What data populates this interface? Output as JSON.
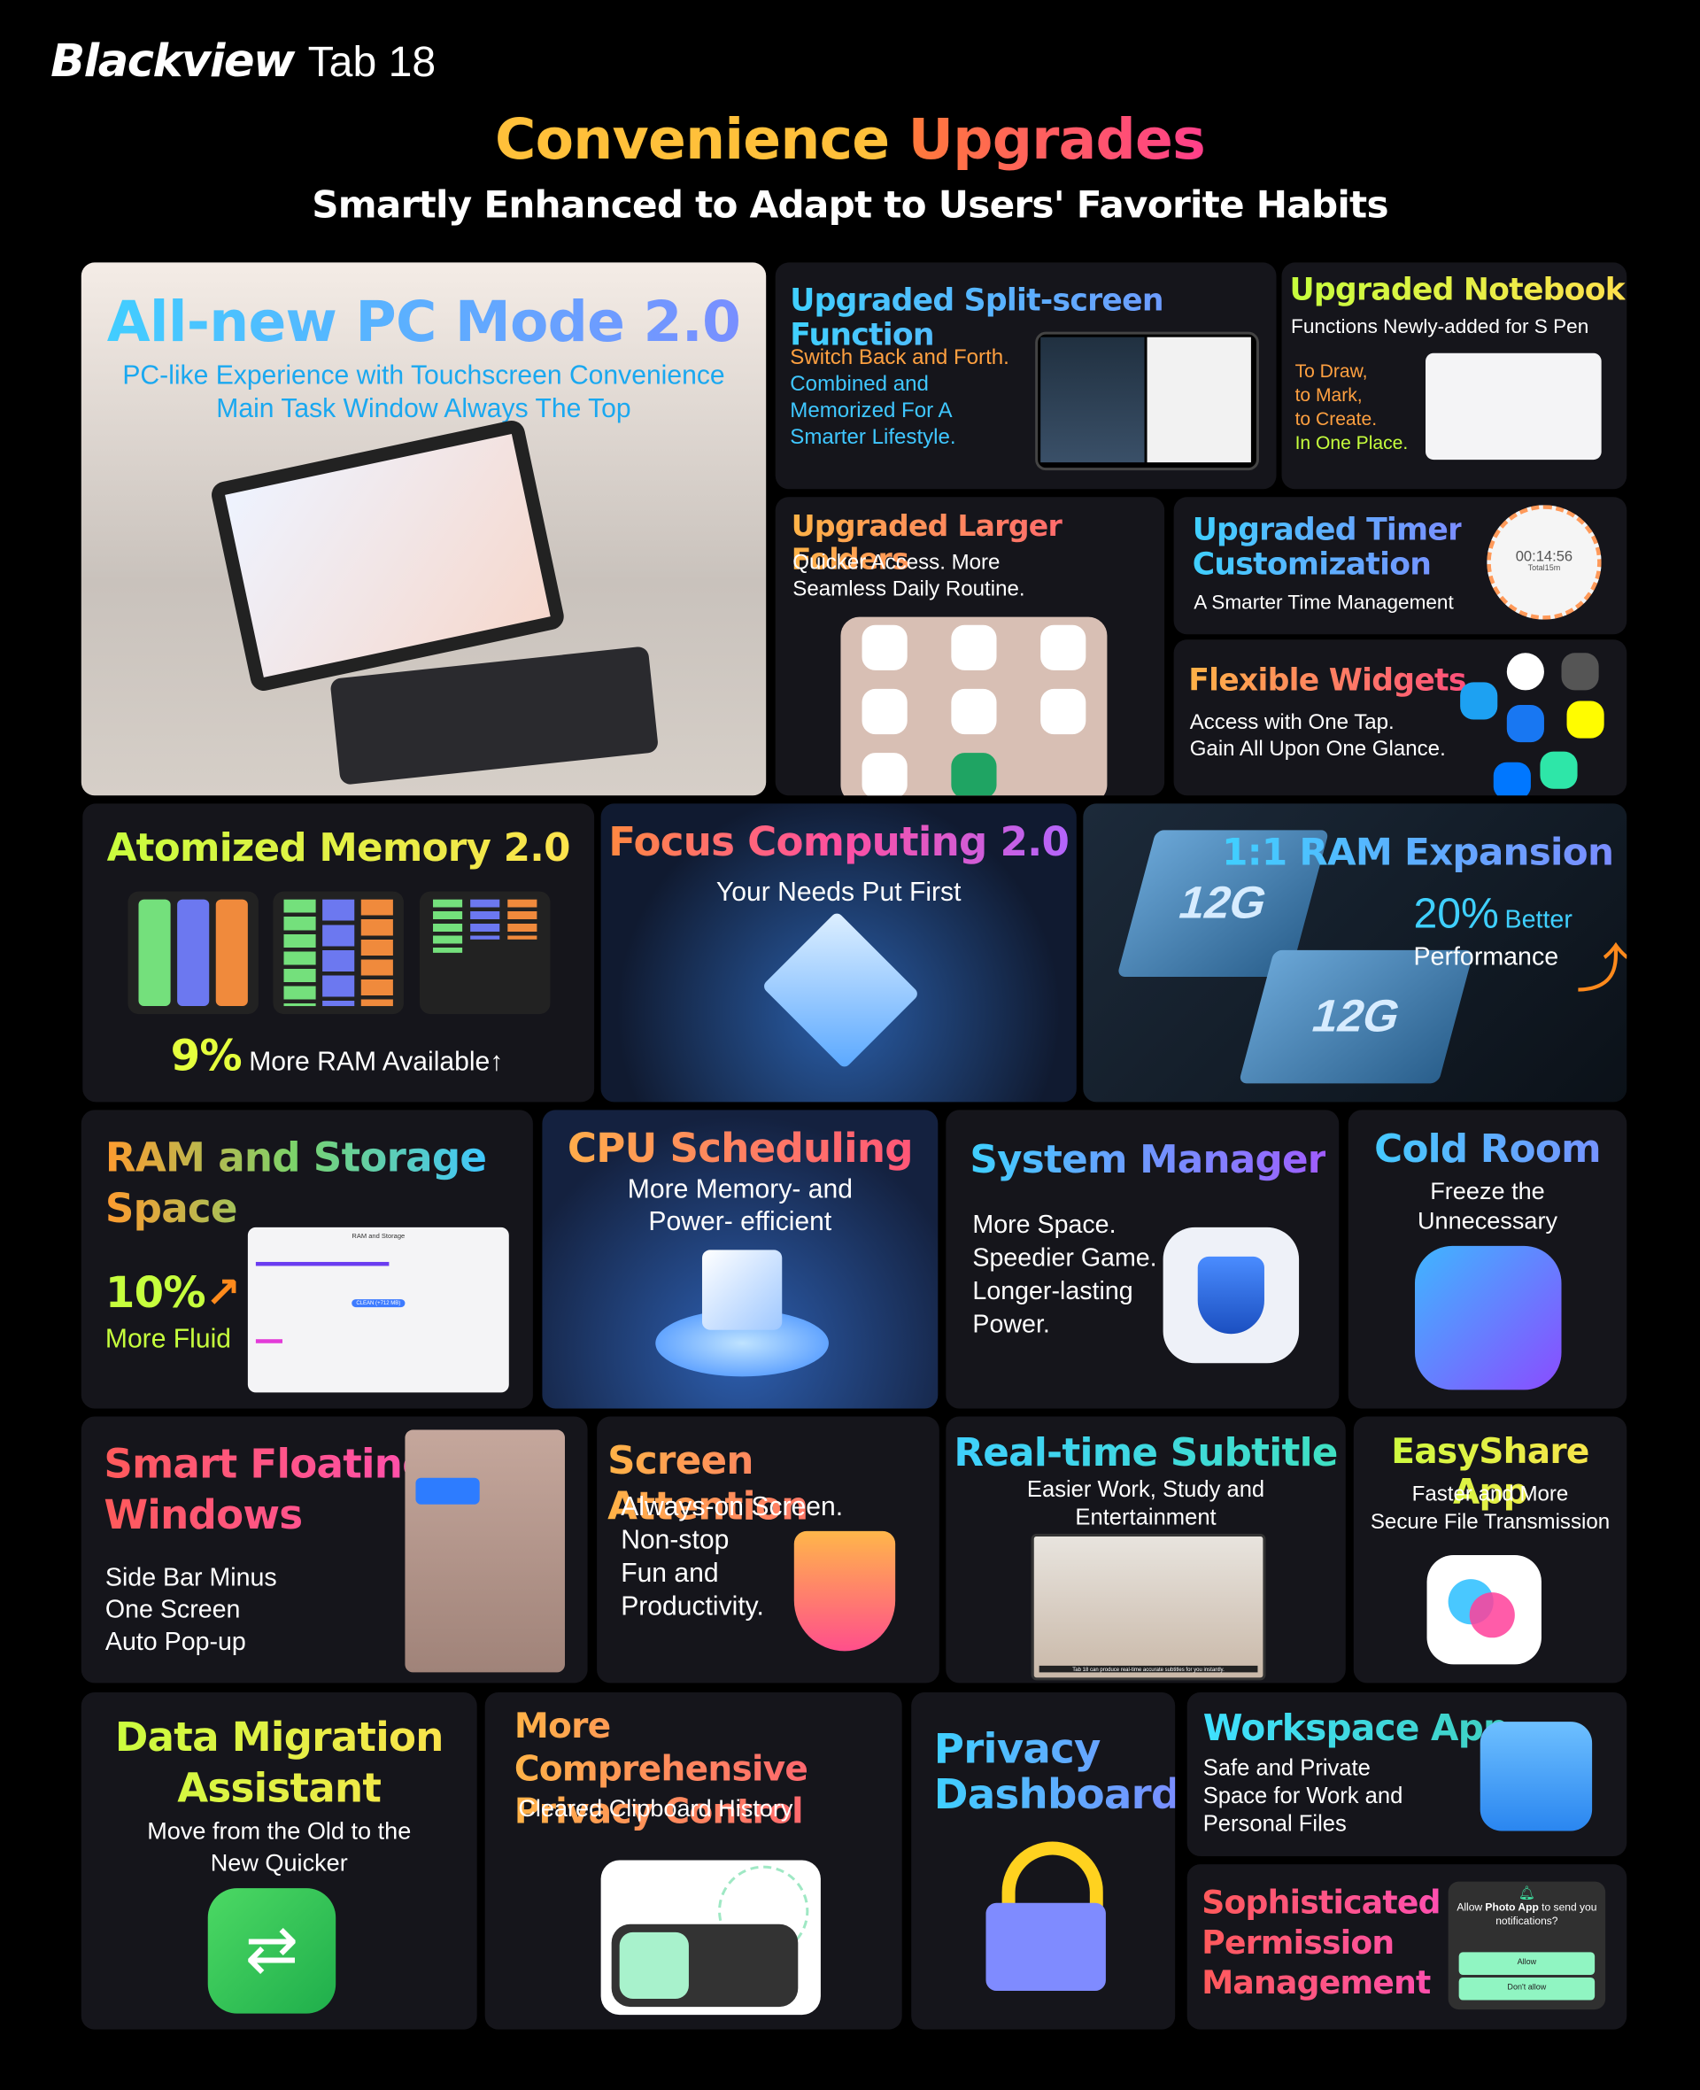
{
  "brand": {
    "logo": "Blackview",
    "model": "Tab 18"
  },
  "header": {
    "title_a": "Convenience",
    "title_b": "Upgrades",
    "subtitle": "Smartly Enhanced to Adapt to Users' Favorite Habits"
  },
  "pc_mode": {
    "title": "All-new PC Mode 2.0",
    "line1": "PC-like Experience with Touchscreen Convenience",
    "line2": "Main Task Window Always The Top"
  },
  "split": {
    "title": "Upgraded Split-screen Function",
    "l1": "Switch Back and Forth.",
    "l2": "Combined and",
    "l3": "Memorized For A",
    "l4": "Smarter Lifestyle."
  },
  "notebook": {
    "title": "Upgraded Notebook",
    "sub": "Functions Newly-added for S Pen",
    "l1": "To Draw,",
    "l2": "to Mark,",
    "l3": "to Create.",
    "l4": "In One Place."
  },
  "folders": {
    "title": "Upgraded Larger Folders",
    "l1": "Quicker Access. More",
    "l2": "Seamless Daily Routine."
  },
  "timer": {
    "title1": "Upgraded Timer",
    "title2": "Customization",
    "sub": "A Smarter Time Management",
    "time": "00:14:56",
    "total": "Total15m"
  },
  "widgets": {
    "title": "Flexible Widgets",
    "l1": "Access with One Tap.",
    "l2": "Gain All Upon One Glance."
  },
  "atomized": {
    "title": "Atomized Memory 2.0",
    "pct": "9%",
    "text": "More RAM Available↑"
  },
  "focus": {
    "title": "Focus Computing 2.0",
    "sub": "Your Needs Put First"
  },
  "ram_exp": {
    "title": "1:1 RAM Expansion",
    "pct": "20%",
    "better": "Better",
    "perf": "Performance",
    "chip1": "12G",
    "chip2": "12G"
  },
  "ram_storage": {
    "title1": "RAM and Storage",
    "title2": "Space",
    "pct": "10%",
    "text": "More Fluid",
    "screen_title": "RAM and Storage",
    "clean": "CLEAN (+712 MB)"
  },
  "cpu": {
    "title": "CPU Scheduling",
    "l1": "More Memory- and",
    "l2": "Power- efficient"
  },
  "sysman": {
    "title": "System Manager",
    "l1": "More Space.",
    "l2": "Speedier Game.",
    "l3": "Longer-lasting",
    "l4": "Power."
  },
  "cold": {
    "title": "Cold Room",
    "l1": "Freeze the",
    "l2": "Unnecessary"
  },
  "floating": {
    "title1": "Smart Floating",
    "title2": "Windows",
    "l1": "Side Bar  Minus",
    "l2": "One Screen",
    "l3": "Auto Pop-up"
  },
  "attention": {
    "title": "Screen Attention",
    "l1": "Always-on Screen.",
    "l2": "Non-stop",
    "l3": "Fun and",
    "l4": "Productivity."
  },
  "subtitle": {
    "title": "Real-time Subtitle",
    "l1": "Easier Work, Study and",
    "l2": "Entertainment",
    "caption": "Tab 18 can produce real-time accurate subtitles for you instantly."
  },
  "easyshare": {
    "title": "EasyShare App",
    "l1": "Faster and More",
    "l2": "Secure File Transmission"
  },
  "migration": {
    "title1": "Data Migration",
    "title2": "Assistant",
    "l1": "Move from the Old to the",
    "l2": "New Quicker"
  },
  "privacy_control": {
    "title1": "More Comprehensive",
    "title2": "Privacy Control",
    "sub": "Cleared Clipboard History"
  },
  "dashboard": {
    "title1": "Privacy",
    "title2": "Dashboard"
  },
  "workspace": {
    "title": "Workspace App",
    "l1": "Safe and Private",
    "l2": "Space for Work and",
    "l3": "Personal Files"
  },
  "permission": {
    "title1": "Sophisticated",
    "title2": "Permission",
    "title3": "Management",
    "dialog_a": "Allow ",
    "dialog_b": "Photo App",
    "dialog_c": " to send you notifications?",
    "allow": "Allow",
    "deny": "Don't allow"
  },
  "colors": {
    "background": "#000000",
    "card": "#15151b",
    "accent_cyan": "#3fd0ff",
    "accent_orange": "#ff9b2f",
    "accent_lime": "#c6ff3d",
    "dialog_button": "#90f5c2"
  }
}
